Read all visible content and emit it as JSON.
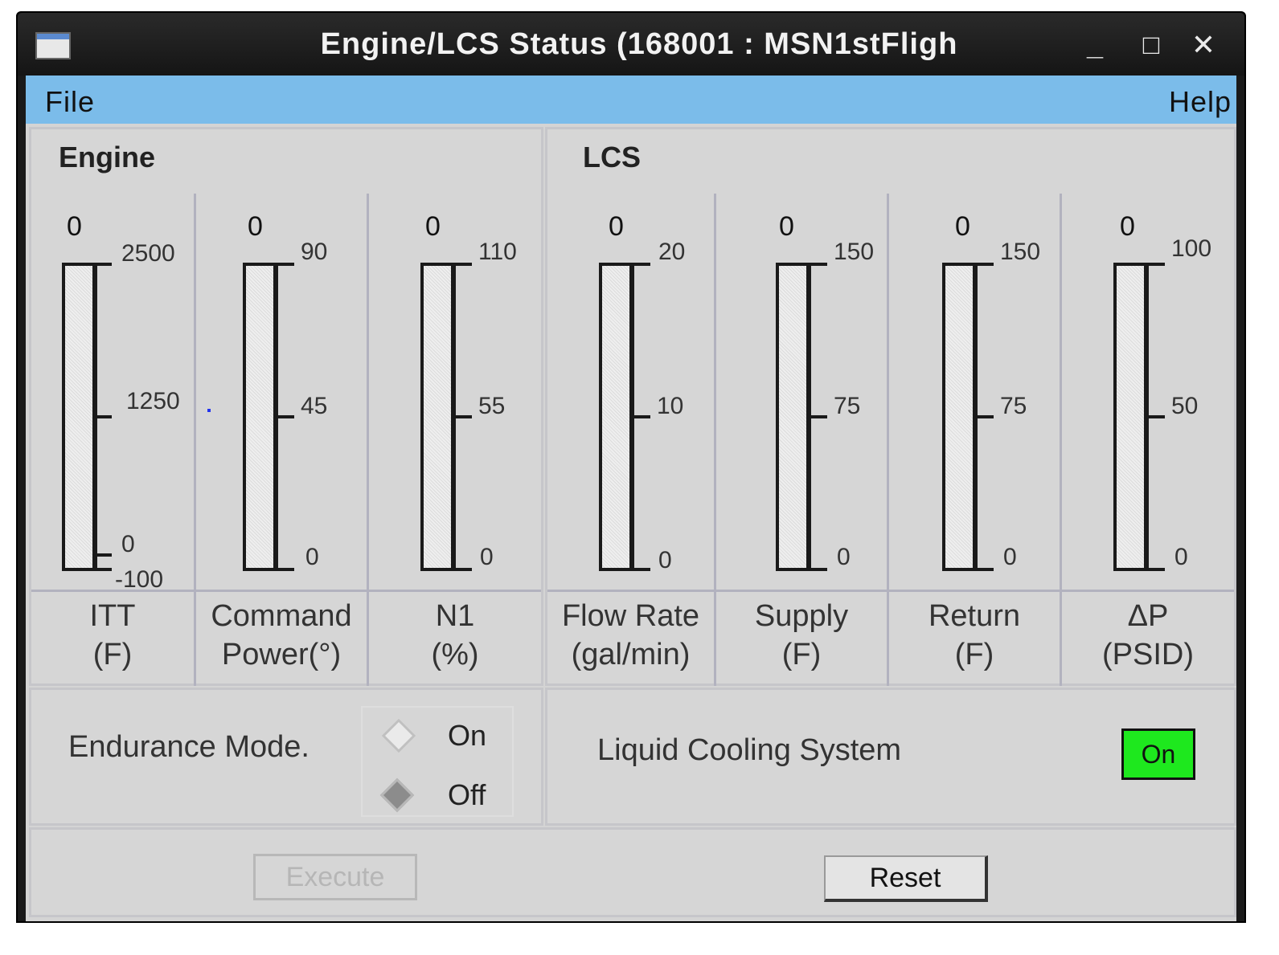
{
  "window": {
    "title": "Engine/LCS Status (168001 : MSN1stFligh",
    "controls": {
      "minimize": "_",
      "maximize": "□",
      "close": "✕"
    }
  },
  "menu": {
    "file": "File",
    "help": "Help"
  },
  "engine": {
    "title": "Engine",
    "gauges": [
      {
        "value": "0",
        "label1": "ITT",
        "label2": "(F)",
        "ticks": [
          "2500",
          "1250",
          "0"
        ],
        "extra_tick": "-100"
      },
      {
        "value": "0",
        "label1": "Command",
        "label2": "Power(°)",
        "ticks": [
          "90",
          "45",
          "0"
        ]
      },
      {
        "value": "0",
        "label1": "N1",
        "label2": "(%)",
        "ticks": [
          "110",
          "55",
          "0"
        ]
      }
    ]
  },
  "lcs": {
    "title": "LCS",
    "gauges": [
      {
        "value": "0",
        "label1": "Flow Rate",
        "label2": "(gal/min)",
        "ticks": [
          "20",
          "10",
          "0"
        ]
      },
      {
        "value": "0",
        "label1": "Supply",
        "label2": "(F)",
        "ticks": [
          "150",
          "75",
          "0"
        ]
      },
      {
        "value": "0",
        "label1": "Return",
        "label2": "(F)",
        "ticks": [
          "150",
          "75",
          "0"
        ]
      },
      {
        "value": "0",
        "label1": "ΔP",
        "label2": "(PSID)",
        "ticks": [
          "100",
          "50",
          "0"
        ]
      }
    ]
  },
  "endurance": {
    "label": "Endurance Mode.",
    "options": [
      {
        "label": "On",
        "selected": false
      },
      {
        "label": "Off",
        "selected": true
      }
    ]
  },
  "cooling": {
    "label": "Liquid Cooling System",
    "status": "On",
    "status_color": "#1ee81e"
  },
  "buttons": {
    "execute": "Execute",
    "reset": "Reset"
  }
}
